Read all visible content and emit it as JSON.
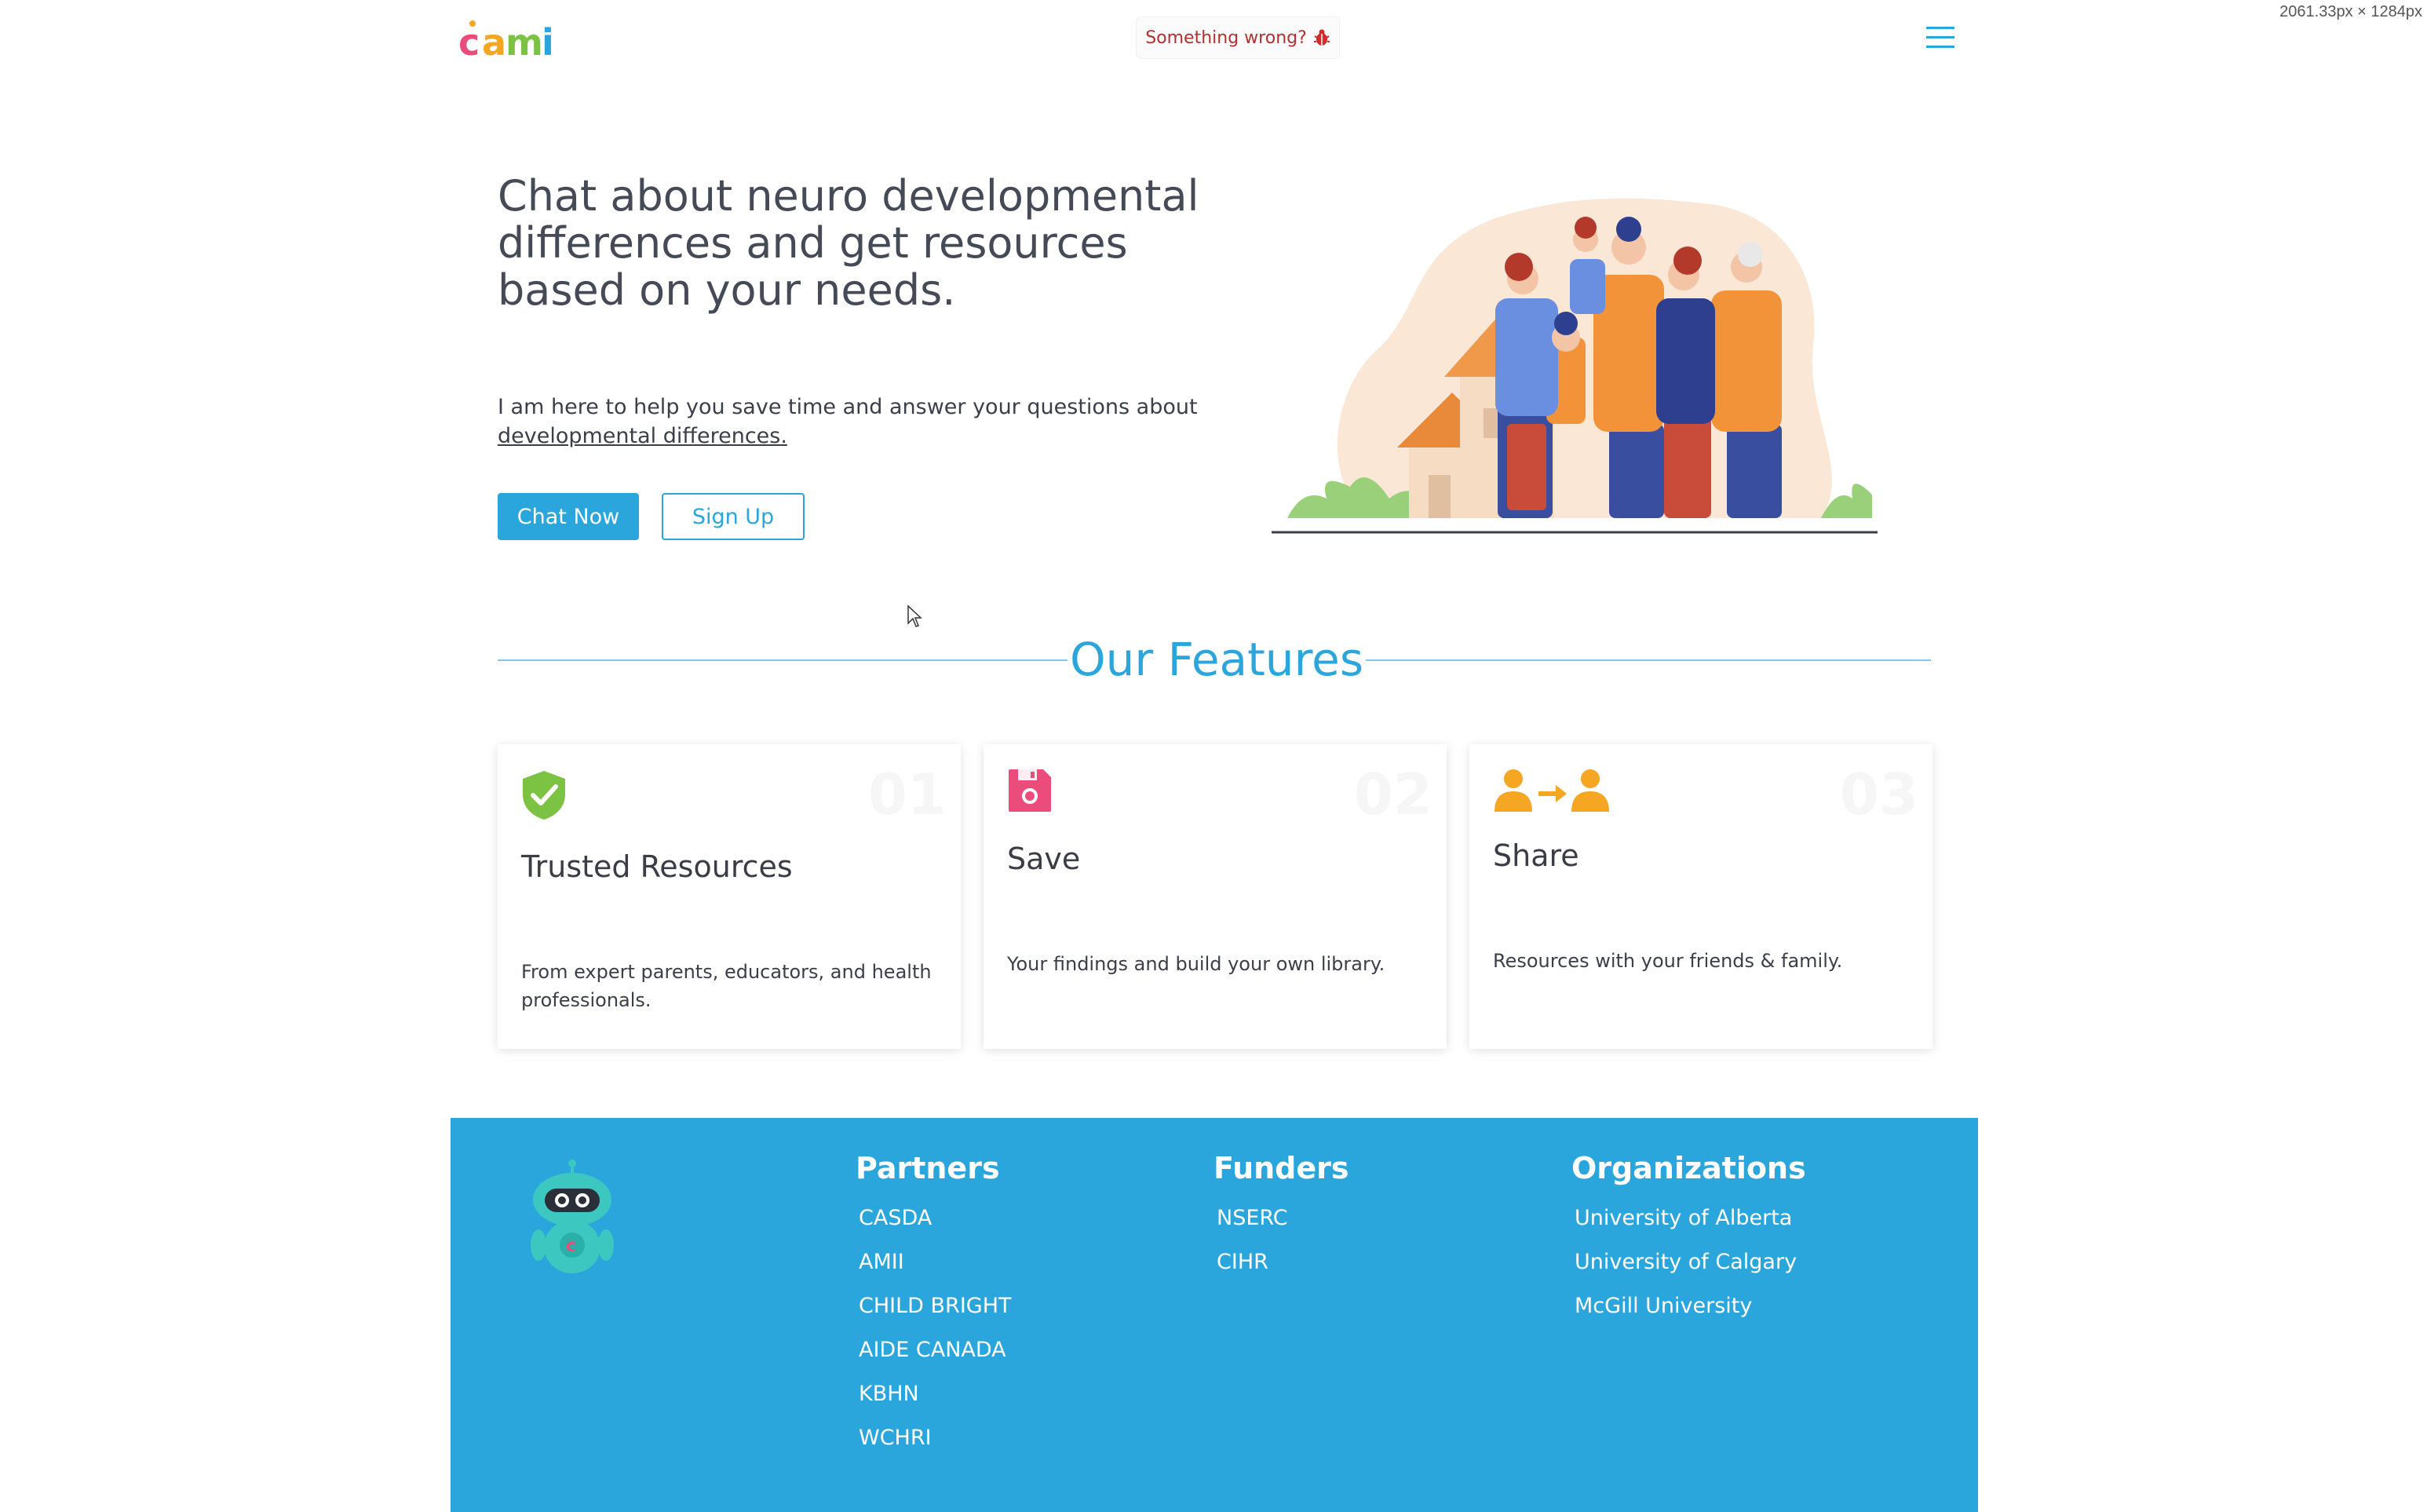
{
  "page": {
    "dimensions_readout": "2061.33px × 1284px"
  },
  "header": {
    "logo_text": "cami",
    "report_label": "Something wrong?",
    "report_icon": "bug-icon",
    "menu_icon": "hamburger-menu-icon"
  },
  "hero": {
    "title": "Chat about neuro developmental differences and get resources based on your needs.",
    "subtitle_text": "I am here to help you save time and answer your questions about ",
    "subtitle_link": "developmental differences.",
    "chat_now_label": "Chat Now",
    "sign_up_label": "Sign Up",
    "illustration": "family-illustration"
  },
  "features": {
    "title": "Our Features",
    "cards": [
      {
        "number": "01",
        "icon": "shield-check-icon",
        "title": "Trusted Resources",
        "description": "From expert parents, educators, and health professionals."
      },
      {
        "number": "02",
        "icon": "floppy-disk-icon",
        "title": "Save",
        "description": "Your findings and build your own library."
      },
      {
        "number": "03",
        "icon": "share-users-icon",
        "title": "Share",
        "description": "Resources with your friends & family."
      }
    ]
  },
  "footer": {
    "mascot": "robot-mascot",
    "columns": [
      {
        "title": "Partners",
        "items": [
          "CASDA",
          "AMII",
          "CHILD BRIGHT",
          "AIDE CANADA",
          "KBHN",
          "WCHRI"
        ]
      },
      {
        "title": "Funders",
        "items": [
          "NSERC",
          "CIHR"
        ]
      },
      {
        "title": "Organizations",
        "items": [
          "University of Alberta",
          "University of Calgary",
          "McGill University"
        ]
      }
    ]
  },
  "colors": {
    "accent": "#2aa6dd",
    "text": "#3b3f4a",
    "report": "#b33030",
    "icon_green": "#7cc243",
    "icon_pink": "#ec4c7c",
    "icon_orange": "#f5a623"
  }
}
